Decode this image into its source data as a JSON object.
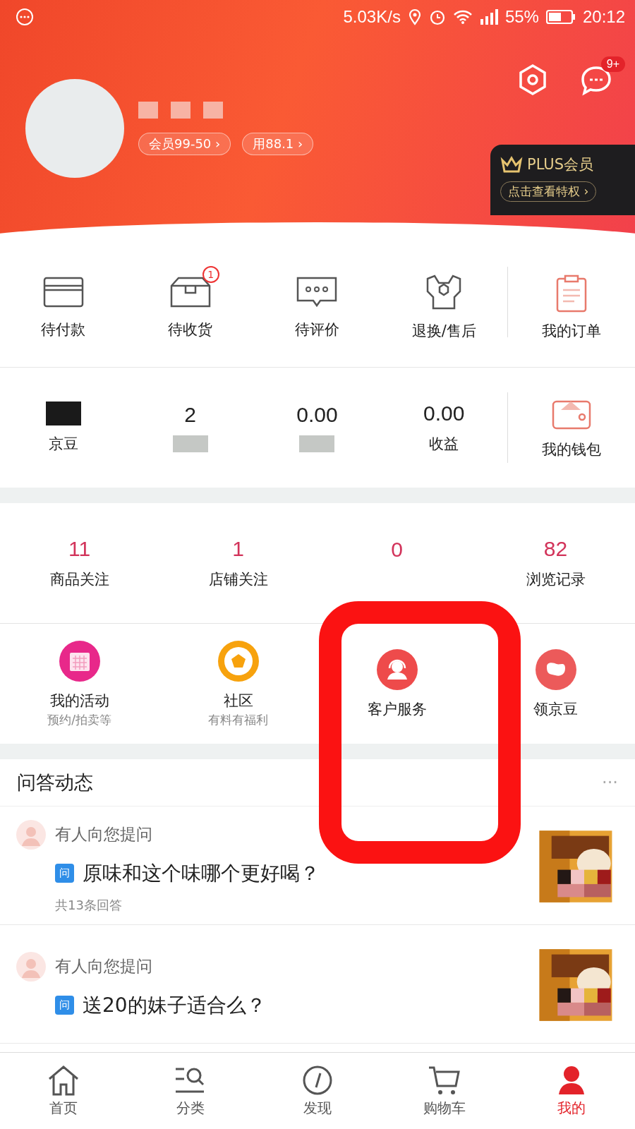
{
  "status_bar": {
    "speed": "5.03K/s",
    "battery": "55%",
    "time": "20:12"
  },
  "header": {
    "message_badge": "9+",
    "member_tags": [
      "会员99-50 ›",
      "用88.1 ›"
    ],
    "plus": {
      "title": "PLUS会员",
      "link": "点击查看特权 ›"
    }
  },
  "orders": {
    "items": [
      {
        "label": "待付款",
        "kind": "card"
      },
      {
        "label": "待收货",
        "kind": "box",
        "badge": "1"
      },
      {
        "label": "待评价",
        "kind": "chat"
      },
      {
        "label": "退换/售后",
        "kind": "wrench"
      }
    ],
    "all": "我的订单"
  },
  "wallet": {
    "items": [
      {
        "label": "京豆"
      },
      {
        "value": "2"
      },
      {
        "value": "0.00"
      },
      {
        "value": "0.00",
        "label": "收益"
      }
    ],
    "all": "我的钱包"
  },
  "follows": [
    {
      "value": "11",
      "label": "商品关注"
    },
    {
      "value": "1",
      "label": "店铺关注"
    },
    {
      "value": "0"
    },
    {
      "value": "82",
      "label": "浏览记录"
    }
  ],
  "tools": [
    {
      "label": "我的活动",
      "sub": "预约/拍卖等",
      "kind": "calendar",
      "color": "#e8288a"
    },
    {
      "label": "社区",
      "sub": "有料有福利",
      "kind": "pentagon",
      "color": "#f7a20d"
    },
    {
      "label": "客户服务",
      "kind": "agent",
      "color": "#ee4b4b"
    },
    {
      "label": "领京豆",
      "kind": "bean",
      "color": "#ec5a5a"
    }
  ],
  "qa": {
    "title": "问答动态",
    "more": "···",
    "items": [
      {
        "who": "有人向您提问",
        "tag": "问",
        "question": "原味和这个味哪个更好喝？",
        "answers": "共13条回答"
      },
      {
        "who": "有人向您提问",
        "tag": "问",
        "question": "送20的妹子适合么？"
      }
    ]
  },
  "tabbar": [
    {
      "label": "首页",
      "kind": "home",
      "selected": false
    },
    {
      "label": "分类",
      "kind": "category",
      "selected": false
    },
    {
      "label": "发现",
      "kind": "compass",
      "selected": false
    },
    {
      "label": "购物车",
      "kind": "cart",
      "selected": false
    },
    {
      "label": "我的",
      "kind": "person",
      "selected": true
    }
  ]
}
